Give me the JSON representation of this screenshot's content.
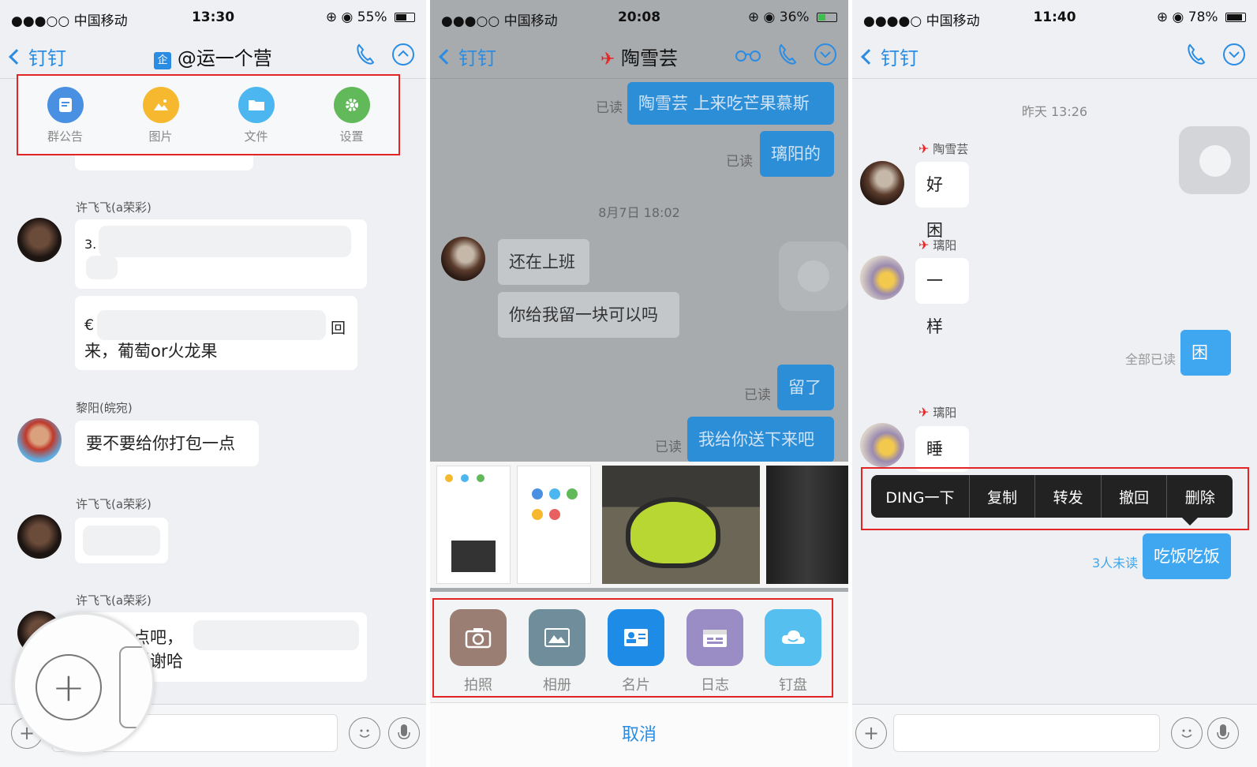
{
  "panels": [
    {
      "status": {
        "carrier": "●●●○○ 中国移动",
        "time": "13:30",
        "battery": "55%",
        "battery_level": 0.55
      },
      "nav": {
        "back": "钉钉",
        "badge": "企",
        "title": "@运一个营"
      },
      "quick_actions": [
        {
          "label": "群公告",
          "icon": "notice-icon",
          "color": "#4a90e2"
        },
        {
          "label": "图片",
          "icon": "picture-icon",
          "color": "#f5b82e"
        },
        {
          "label": "文件",
          "icon": "folder-icon",
          "color": "#4bb6f0"
        },
        {
          "label": "设置",
          "icon": "gear-icon",
          "color": "#62b95a"
        }
      ],
      "messages": [
        {
          "sender": "许飞飞(a荣彩)",
          "text_start": "3.",
          "text_end": ""
        },
        {
          "text_start": "€",
          "text_mid": "回",
          "line2": "来，葡萄or火龙果"
        },
        {
          "sender": "黎阳(皖宛)",
          "text": "要不要给你打包一点"
        },
        {
          "sender": "许飞飞(a荣彩)"
        },
        {
          "sender": "许飞飞(a荣彩)",
          "line1": "点吧，",
          "line2": "谢谢哈"
        }
      ]
    },
    {
      "status": {
        "carrier": "●●●○○ 中国移动",
        "time": "20:08",
        "battery": "36%",
        "battery_level": 0.36
      },
      "nav": {
        "back": "钉钉",
        "title": "陶雪芸"
      },
      "messages": [
        {
          "read": "已读",
          "text": "陶雪芸 上来吃芒果慕斯"
        },
        {
          "read": "已读",
          "text": "璃阳的"
        },
        {
          "time": "8月7日 18:02"
        },
        {
          "text": "还在上班"
        },
        {
          "text": "你给我留一块可以吗"
        },
        {
          "read": "已读",
          "text": "留了"
        },
        {
          "read": "已读",
          "text": "我给你送下来吧"
        }
      ],
      "actions": [
        {
          "label": "拍照",
          "icon": "camera-icon",
          "color": "#9a7e74"
        },
        {
          "label": "相册",
          "icon": "album-icon",
          "color": "#6f8d9b"
        },
        {
          "label": "名片",
          "icon": "contact-card-icon",
          "color": "#1e8ce6"
        },
        {
          "label": "日志",
          "icon": "log-icon",
          "color": "#9a8cc4"
        },
        {
          "label": "钉盘",
          "icon": "cloud-icon",
          "color": "#55c0ef"
        }
      ],
      "cancel": "取消"
    },
    {
      "status": {
        "carrier": "●●●●○ 中国移动",
        "time": "11:40",
        "battery": "78%",
        "battery_level": 0.78
      },
      "nav": {
        "back": "钉钉"
      },
      "messages": [
        {
          "time": "昨天 13:26"
        },
        {
          "sender": "陶雪芸",
          "text": "好困"
        },
        {
          "sender": "璃阳",
          "text": "一样"
        },
        {
          "read": "全部已读",
          "text": "困"
        },
        {
          "sender": "璃阳",
          "text": "睡会"
        },
        {
          "read": "3人未读",
          "text": "吃饭吃饭"
        }
      ],
      "context_menu": [
        "DING一下",
        "复制",
        "转发",
        "撤回",
        "删除"
      ]
    }
  ]
}
